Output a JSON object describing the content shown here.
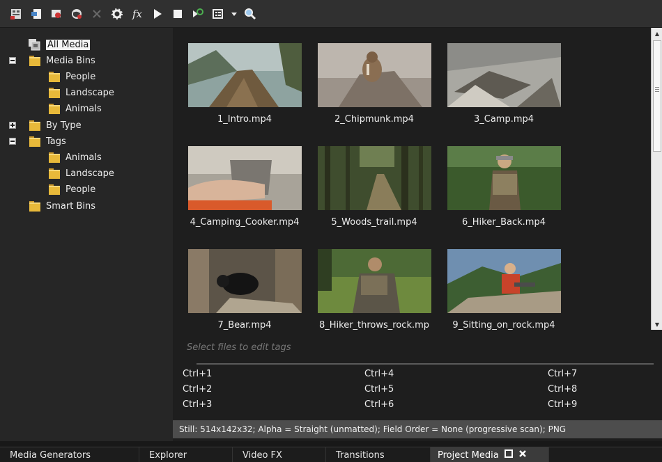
{
  "toolbar": {
    "buttons": [
      {
        "name": "import-media-icon"
      },
      {
        "name": "open-file-icon"
      },
      {
        "name": "capture-video-icon"
      },
      {
        "name": "get-media-from-web-icon"
      },
      {
        "name": "remove-media-icon"
      },
      {
        "name": "media-properties-icon"
      },
      {
        "name": "media-fx-icon",
        "glyph": "fx"
      },
      {
        "name": "play-icon"
      },
      {
        "name": "stop-icon"
      },
      {
        "name": "auto-preview-icon"
      },
      {
        "name": "views-icon"
      },
      {
        "name": "views-dropdown-icon"
      },
      {
        "name": "search-icon"
      }
    ]
  },
  "tree": {
    "all_media": "All Media",
    "media_bins": "Media Bins",
    "bins": [
      "People",
      "Landscape",
      "Animals"
    ],
    "by_type": "By Type",
    "tags": "Tags",
    "tag_items": [
      "Animals",
      "Landscape",
      "People"
    ],
    "smart_bins": "Smart Bins"
  },
  "media": [
    {
      "name": "1_Intro.mp4"
    },
    {
      "name": "2_Chipmunk.mp4"
    },
    {
      "name": "3_Camp.mp4"
    },
    {
      "name": "4_Camping_Cooker.mp4"
    },
    {
      "name": "5_Woods_trail.mp4"
    },
    {
      "name": "6_Hiker_Back.mp4"
    },
    {
      "name": "7_Bear.mp4"
    },
    {
      "name": "8_Hiker_throws_rock.mp"
    },
    {
      "name": "9_Sitting_on_rock.mp4"
    }
  ],
  "tags_panel": {
    "placeholder": "Select files to edit tags",
    "shortcuts": [
      "Ctrl+1",
      "Ctrl+2",
      "Ctrl+3",
      "Ctrl+4",
      "Ctrl+5",
      "Ctrl+6",
      "Ctrl+7",
      "Ctrl+8",
      "Ctrl+9"
    ]
  },
  "status": "Still: 514x142x32; Alpha = Straight (unmatted); Field Order = None (progressive scan); PNG",
  "bottom_tabs": [
    {
      "label": "Media Generators"
    },
    {
      "label": "Explorer"
    },
    {
      "label": "Video FX"
    },
    {
      "label": "Transitions"
    },
    {
      "label": "Project Media",
      "active": true
    }
  ],
  "colors": {
    "folder": "#e8b93a",
    "panel_bg": "#262626",
    "grid_bg": "#1e1e1e",
    "status_bg": "#4d4d4d",
    "active_tab": "#3b3b3b"
  }
}
